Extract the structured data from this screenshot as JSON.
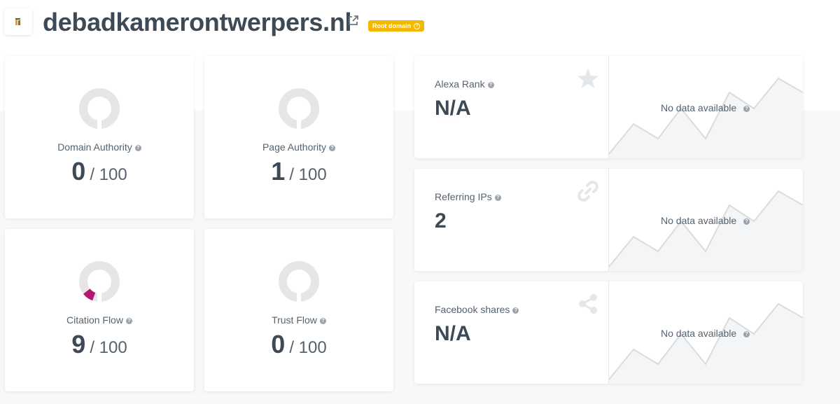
{
  "header": {
    "domain": "debadkamerontwerpers.nl",
    "badge_label": "Root domain",
    "external_link_icon": "external-link-icon",
    "colors": {
      "badge": "#f5b800",
      "title": "#3d4a55"
    }
  },
  "metrics": [
    {
      "label": "Domain Authority",
      "value": "0",
      "suffix": "/ 100",
      "fraction": 0.0
    },
    {
      "label": "Page Authority",
      "value": "1",
      "suffix": "/ 100",
      "fraction": 0.01
    },
    {
      "label": "Citation Flow",
      "value": "9",
      "suffix": "/ 100",
      "fraction": 0.09,
      "color": "#b5176e"
    },
    {
      "label": "Trust Flow",
      "value": "0",
      "suffix": "/ 100",
      "fraction": 0.0
    }
  ],
  "stats": [
    {
      "title": "Alexa Rank",
      "value": "N/A",
      "icon": "star-icon",
      "chart_message": "No data available"
    },
    {
      "title": "Referring IPs",
      "value": "2",
      "icon": "link-icon",
      "chart_message": "No data available"
    },
    {
      "title": "Facebook shares",
      "value": "N/A",
      "icon": "share-icon",
      "chart_message": "No data available"
    }
  ]
}
